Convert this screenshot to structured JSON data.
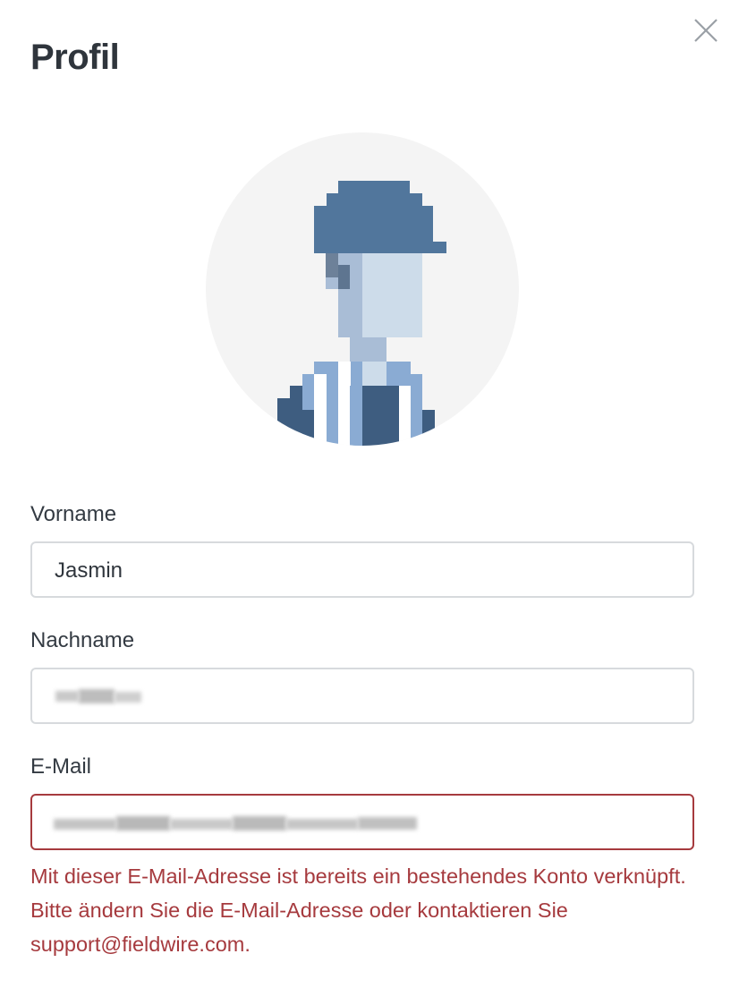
{
  "dialog": {
    "title": "Profil",
    "close_icon": "close-icon"
  },
  "avatar": {
    "icon": "construction-worker-avatar-icon",
    "bg_color": "#f4f4f4",
    "helmet_color": "#51769c"
  },
  "fields": {
    "first_name": {
      "label": "Vorname",
      "value": "Jasmin"
    },
    "last_name": {
      "label": "Nachname"
    },
    "email": {
      "label": "E-Mail",
      "error": "Mit dieser E-Mail-Adresse ist bereits ein bestehendes Konto verknüpft. Bitte ändern Sie die E-Mail-Adresse oder kontaktieren Sie support@fieldwire.com."
    }
  },
  "colors": {
    "error": "#a63a3e",
    "input_border": "#d7dadd",
    "text": "#333a42"
  }
}
